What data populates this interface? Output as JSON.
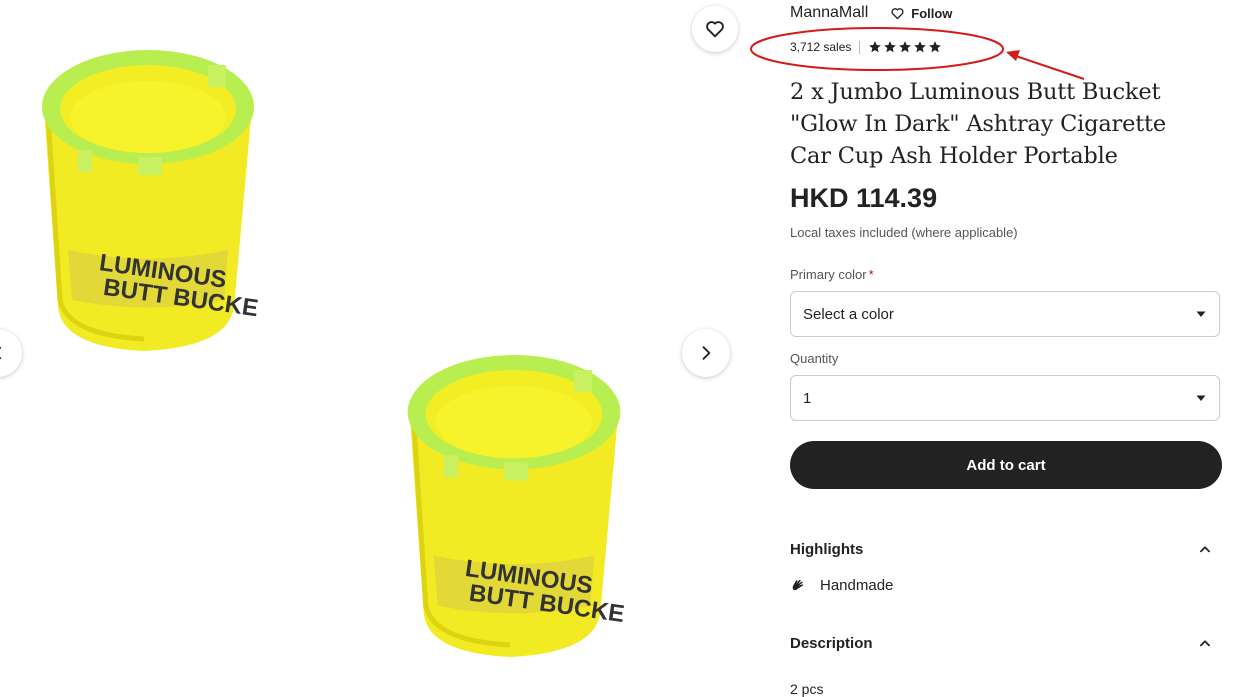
{
  "shop": {
    "name": "MannaMall",
    "follow_label": "Follow"
  },
  "sales": {
    "count_label": "3,712 sales",
    "rating_stars": 5
  },
  "product": {
    "title": "2 x Jumbo Luminous Butt Bucket \"Glow In Dark\" Ashtray Cigarette Car Cup Ash Holder Portable",
    "price": "HKD 114.39",
    "tax_note": "Local taxes included (where applicable)",
    "image_label_line1": "LUMINOUS",
    "image_label_line2": "BUTT BUCKET"
  },
  "options": {
    "color_label": "Primary color",
    "required_mark": "*",
    "color_value": "Select a color",
    "quantity_label": "Quantity",
    "quantity_value": "1"
  },
  "cart": {
    "button_label": "Add to cart"
  },
  "highlights": {
    "heading": "Highlights",
    "items": [
      "Handmade"
    ]
  },
  "description": {
    "heading": "Description",
    "peek_text": "2 pcs"
  },
  "colors": {
    "accent_dark": "#222222",
    "required_red": "#a61a2e",
    "annotation_red": "#d41b1b",
    "product_yellow": "#f2ea22",
    "rim_green": "#b8ee50"
  },
  "icons": {
    "favorite": "heart-icon",
    "next": "chevron-right-icon",
    "previous": "chevron-left-icon",
    "dropdown": "caret-down-icon",
    "collapse": "chevron-up-icon",
    "handmade": "hand-icon",
    "rating": "star-icon"
  }
}
